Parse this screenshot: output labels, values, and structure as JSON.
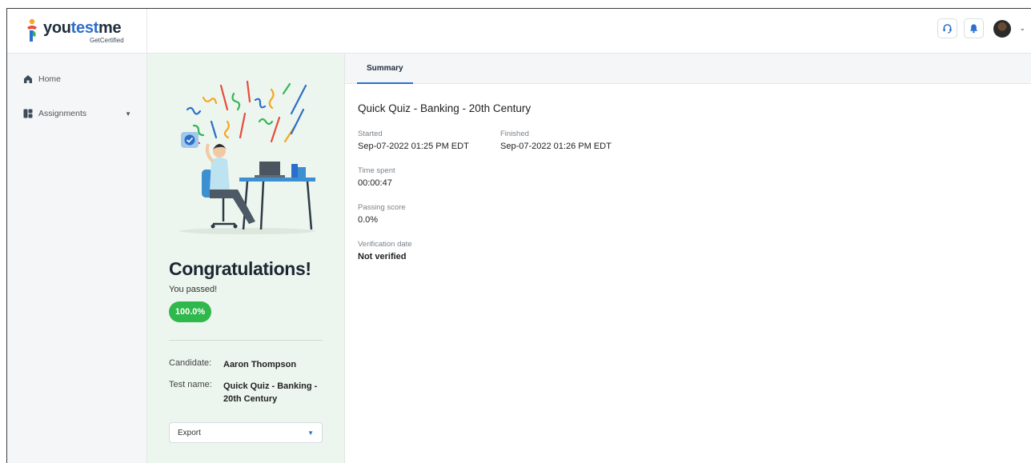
{
  "brand": {
    "name_part1": "you",
    "name_part2": "test",
    "name_part3": "me",
    "tagline": "GetCertified"
  },
  "header": {
    "icons": [
      "headset-icon",
      "bell-icon",
      "avatar"
    ]
  },
  "sidebar": {
    "items": [
      {
        "label": "Home",
        "icon": "home-icon"
      },
      {
        "label": "Assignments",
        "icon": "assignments-icon",
        "caret": "▼"
      }
    ]
  },
  "result": {
    "title": "Congratulations!",
    "status": "You passed!",
    "score": "100.0%",
    "candidate_label": "Candidate:",
    "candidate_value": "Aaron Thompson",
    "test_label": "Test name:",
    "test_value": "Quick Quiz - Banking - 20th Century",
    "export_label": "Export",
    "export_caret": "▼"
  },
  "main": {
    "tab": "Summary",
    "quiz_title": "Quick Quiz - Banking - 20th Century",
    "started_label": "Started",
    "started_value": "Sep-07-2022 01:25 PM EDT",
    "finished_label": "Finished",
    "finished_value": "Sep-07-2022 01:26 PM EDT",
    "time_label": "Time spent",
    "time_value": "00:00:47",
    "passing_label": "Passing score",
    "passing_value": "0.0%",
    "verification_label": "Verification date",
    "verification_value": "Not verified"
  },
  "colors": {
    "accent": "#2c6ecb",
    "success": "#2fb84b",
    "panel_bg": "#edf6ee"
  }
}
